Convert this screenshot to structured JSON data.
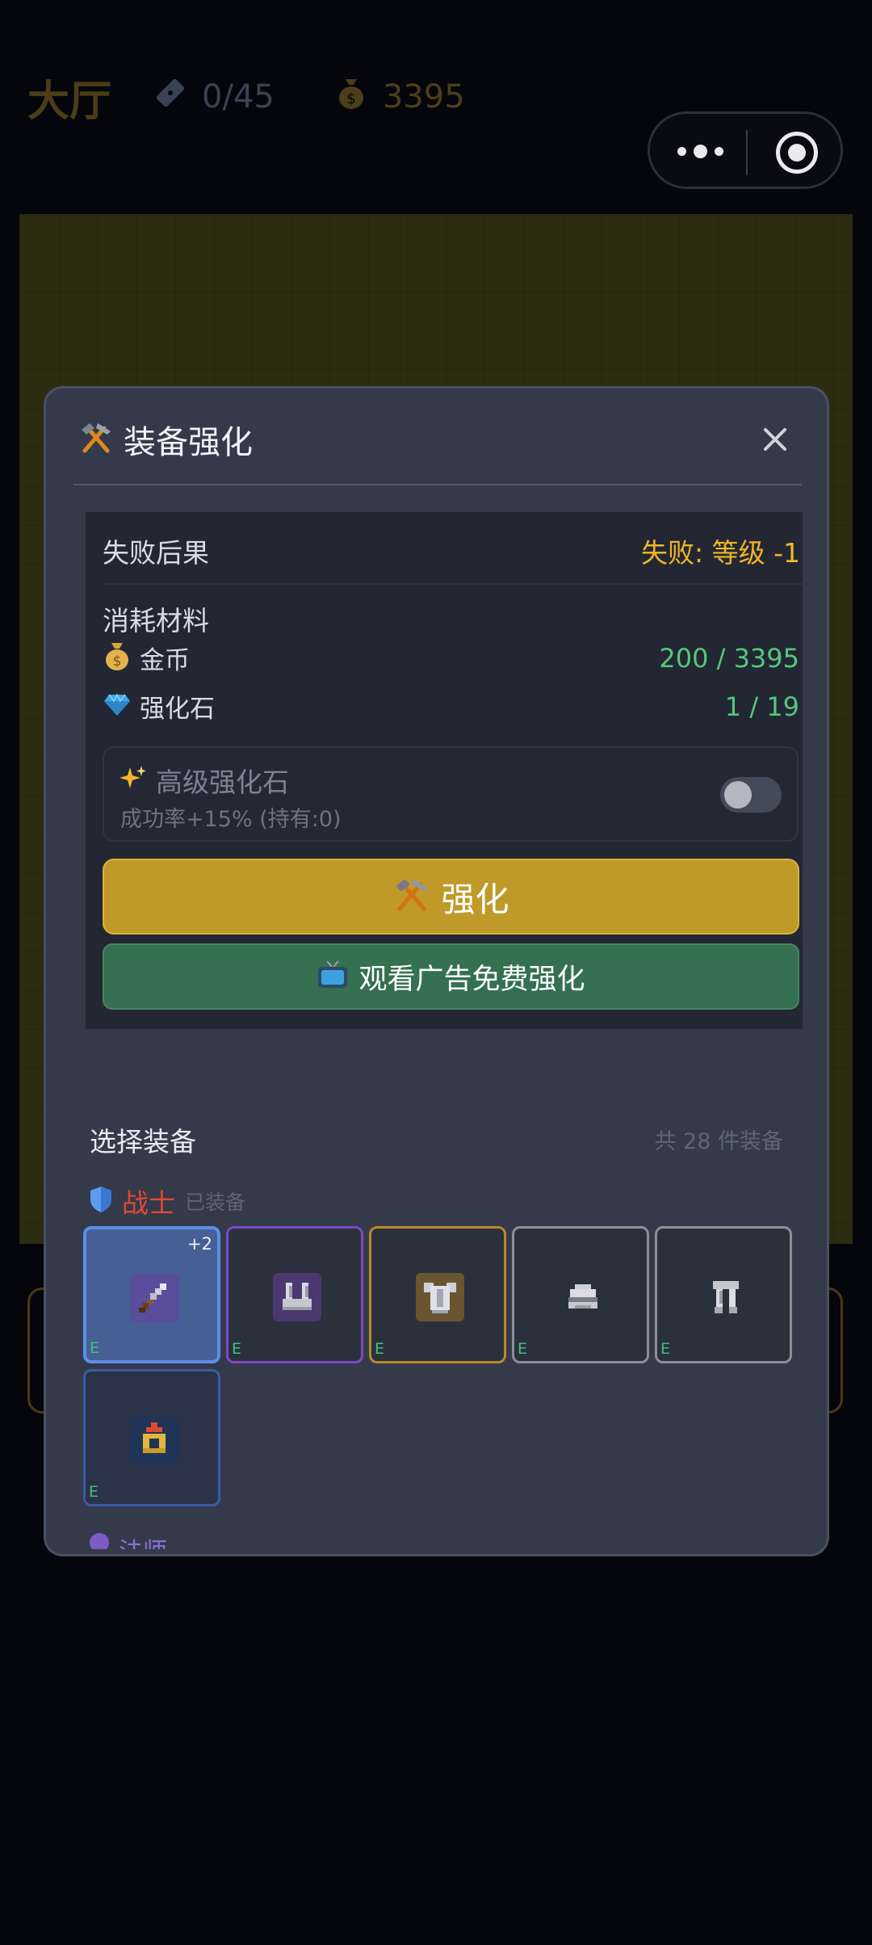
{
  "background": {
    "hall_title": "大厅",
    "tickets": "0/45",
    "gold": "3395"
  },
  "modal": {
    "title": "装备强化",
    "fail_label": "失败后果",
    "fail_value": "失败: 等级 -1",
    "materials_title": "消耗材料",
    "gold_label": "金币",
    "gold_value": "200 / 3395",
    "stone_label": "强化石",
    "stone_value": "1 / 19",
    "advanced_label": "高级强化石",
    "advanced_sub": "成功率+15% (持有:0)",
    "advanced_enabled": false,
    "enhance_button": "强化",
    "ad_button": "观看广告免费强化",
    "select_title": "选择装备",
    "select_count": "共 28 件装备",
    "class_name": "战士",
    "class_status": "已装备",
    "next_class_name": "法师",
    "items": [
      {
        "icon": "sword-icon",
        "tag": "E",
        "level": "+2",
        "rarity": "selected"
      },
      {
        "icon": "leg-armor-icon",
        "tag": "E",
        "rarity": "epic"
      },
      {
        "icon": "chest-armor-icon",
        "tag": "E",
        "rarity": "legendary"
      },
      {
        "icon": "helmet-icon",
        "tag": "E",
        "rarity": "common"
      },
      {
        "icon": "greaves-icon",
        "tag": "E",
        "rarity": "common"
      },
      {
        "icon": "amulet-icon",
        "tag": "E",
        "rarity": "rare"
      }
    ]
  },
  "colors": {
    "accent_gold": "#c09a29",
    "ad_green": "#357050",
    "fail_orange": "#f0b429",
    "value_green": "#56c77a",
    "class_red": "#e04a33"
  }
}
